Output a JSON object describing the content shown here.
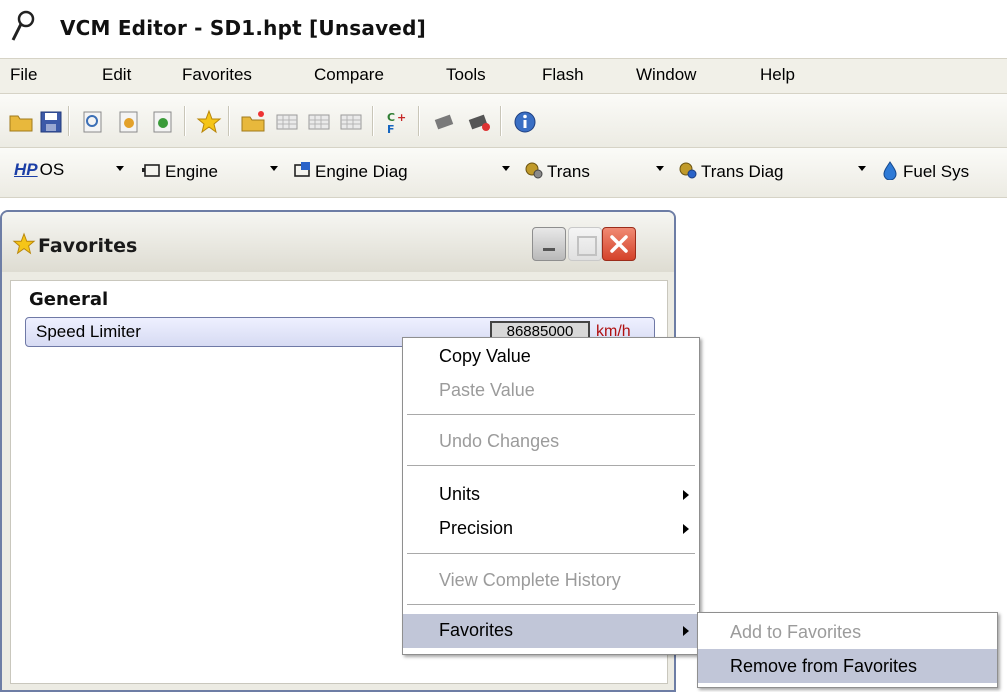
{
  "window": {
    "title": "VCM Editor - SD1.hpt    [Unsaved]"
  },
  "menubar": {
    "items": [
      "File",
      "Edit",
      "Favorites",
      "Compare",
      "Tools",
      "Flash",
      "Window",
      "Help"
    ]
  },
  "toolbar": {
    "buttons": [
      "open-icon",
      "save-icon",
      "find-icon",
      "import-icon",
      "export-icon",
      "favorites-star-icon",
      "new-folder-icon",
      "table-icon-1",
      "table-icon-2",
      "table-icon-3",
      "compare-icon",
      "read-vehicle-icon",
      "write-vehicle-icon",
      "info-icon"
    ]
  },
  "categories": {
    "hp_logo": "HP",
    "items": [
      "OS",
      "Engine",
      "Engine Diag",
      "Trans",
      "Trans Diag",
      "Fuel Sys"
    ]
  },
  "favorites_window": {
    "title": "Favorites",
    "group": "General",
    "row": {
      "label": "Speed Limiter",
      "value": "86885000",
      "unit": "km/h"
    }
  },
  "context_menu": {
    "copy_value": "Copy Value",
    "paste_value": "Paste Value",
    "undo_changes": "Undo Changes",
    "units": "Units",
    "precision": "Precision",
    "view_history": "View Complete History",
    "favorites": "Favorites"
  },
  "submenu": {
    "add": "Add to Favorites",
    "remove": "Remove from Favorites"
  },
  "colors": {
    "highlight": "#c1c6d8",
    "disabled_text": "#9b9b9b",
    "unit_red": "#b01010",
    "window_border": "#6d7da5"
  }
}
